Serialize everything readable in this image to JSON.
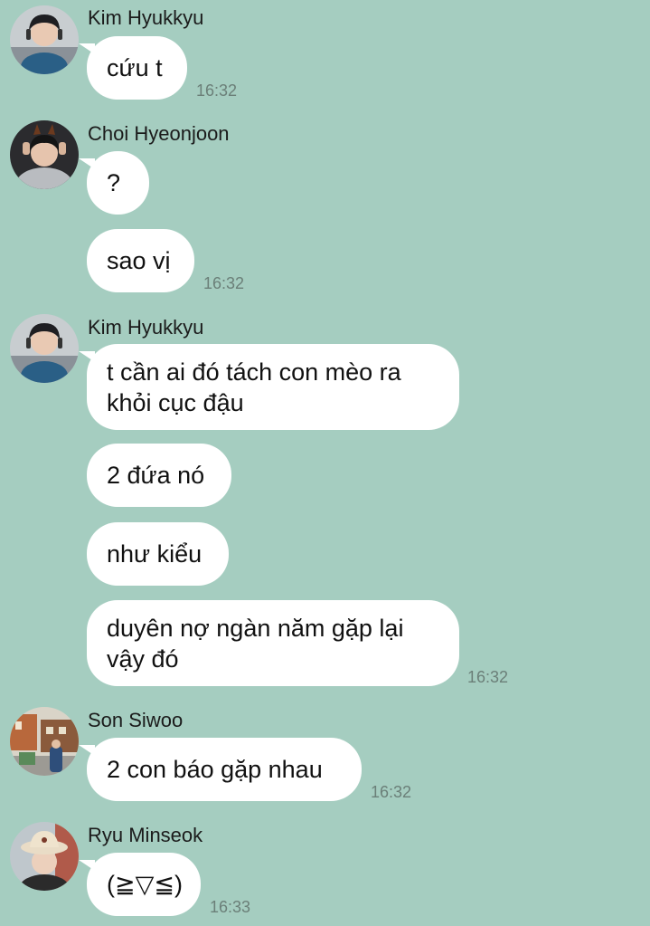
{
  "messages": [
    {
      "sender": "Kim Hyukkyu",
      "bubbles": [
        "cứu t"
      ],
      "time": "16:32"
    },
    {
      "sender": "Choi Hyeonjoon",
      "bubbles": [
        "?",
        "sao vị"
      ],
      "time": "16:32"
    },
    {
      "sender": "Kim Hyukkyu",
      "bubbles": [
        "t cần ai đó tách con mèo ra\nkhỏi cục đậu",
        "2 đứa nó",
        "như kiểu",
        "duyên nợ ngàn năm gặp lại\nvậy đó"
      ],
      "time": "16:32"
    },
    {
      "sender": "Son Siwoo",
      "bubbles": [
        "2 con báo gặp nhau"
      ],
      "time": "16:32"
    },
    {
      "sender": "Ryu Minseok",
      "bubbles": [
        "(≧▽≦)"
      ],
      "time": "16:33"
    }
  ],
  "colors": {
    "background": "#a5cdc0",
    "bubble": "#ffffff",
    "timestamp": "#6b7f78"
  },
  "avatars": [
    "avatar-kim-hyukkyu",
    "avatar-choi-hyeonjoon",
    "avatar-kim-hyukkyu",
    "avatar-son-siwoo",
    "avatar-ryu-minseok"
  ]
}
